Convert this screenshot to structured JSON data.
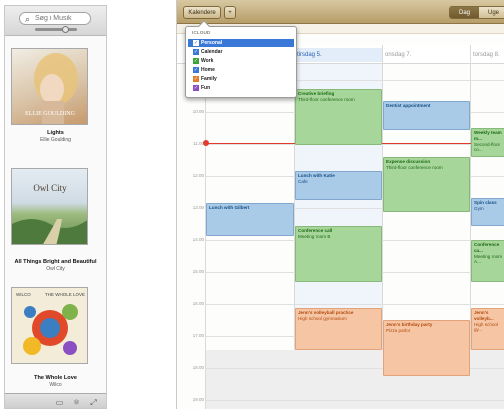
{
  "itunes": {
    "search": {
      "placeholder": "Søg i Musik",
      "value": ""
    },
    "albums": [
      {
        "title": "Lights",
        "artist": "Ellie Goulding",
        "cover_text": "ELLIE GOULDING",
        "colors": [
          "#e9e2d4",
          "#c9a987",
          "#e6bc72"
        ]
      },
      {
        "title": "All Things Bright and Beautiful",
        "artist": "Owl City",
        "cover_text": "Owl City",
        "colors": [
          "#dfe9f2",
          "#8fb07a",
          "#3b6f3a"
        ]
      },
      {
        "title": "The Whole Love",
        "artist": "Wilco",
        "cover_text_left": "WILCO",
        "cover_text_right": "THE WHOLE LOVE",
        "colors": [
          "#f3ecd9",
          "#e04a2a",
          "#3b7ec2"
        ]
      }
    ],
    "bottom_icons": [
      "airplay-icon",
      "genius-icon",
      "fullscreen-icon"
    ]
  },
  "calendar": {
    "toolbar": {
      "calendars_button": "Kalendere",
      "add_button": "+",
      "view_day": "Dag",
      "view_week": "Uge"
    },
    "day_headers": [
      {
        "label": "tirsdag 5.",
        "highlight": true
      },
      {
        "label": "onsdag 7.",
        "highlight": false
      },
      {
        "label": "torsdag 8.",
        "highlight": false
      }
    ],
    "hours": [
      "09.00",
      "10.00",
      "11.00",
      "12.00",
      "13.00",
      "14.00",
      "15.00",
      "16.00",
      "17.00",
      "18.00",
      "19.00"
    ],
    "current_time": "11.12",
    "popover": {
      "title": "ICLOUD",
      "calendars": [
        {
          "name": "Personal",
          "selected": true,
          "color": "#3a78d8"
        },
        {
          "name": "Calendar",
          "selected": false,
          "color": "#3a78d8"
        },
        {
          "name": "Work",
          "selected": false,
          "color": "#3da33a"
        },
        {
          "name": "Home",
          "selected": false,
          "color": "#3a78d8"
        },
        {
          "name": "Family",
          "selected": false,
          "color": "#e07f2a"
        },
        {
          "name": "Fun",
          "selected": false,
          "color": "#8a4fc3"
        }
      ]
    },
    "events": [
      {
        "title": "Creative briefing",
        "detail": "Third-floor conference room",
        "color": "green"
      },
      {
        "title": "Dentist appointment",
        "detail": "",
        "color": "blue"
      },
      {
        "title": "Weekly team m...",
        "detail": "Second-floor co...",
        "color": "green"
      },
      {
        "title": "Expense discussion",
        "detail": "Third-floor conference room",
        "color": "green"
      },
      {
        "title": "Lunch with Katie",
        "detail": "Cafe",
        "color": "blue"
      },
      {
        "title": "Spin class",
        "detail": "Gym",
        "color": "blue"
      },
      {
        "title": "Lunch with Gilbert",
        "detail": "",
        "color": "blue"
      },
      {
        "title": "Conference call",
        "detail": "Meeting room B",
        "color": "green"
      },
      {
        "title": "Conference ca...",
        "detail": "Meeting room A...",
        "color": "green"
      },
      {
        "title": "Jenn's volleyball practice",
        "detail": "High school gymnasium",
        "color": "orange"
      },
      {
        "title": "Jenn's birthday party",
        "detail": "Pizza parlor",
        "color": "orange"
      },
      {
        "title": "Jenn's volleyb...",
        "detail": "High school gy...",
        "color": "orange"
      }
    ]
  }
}
